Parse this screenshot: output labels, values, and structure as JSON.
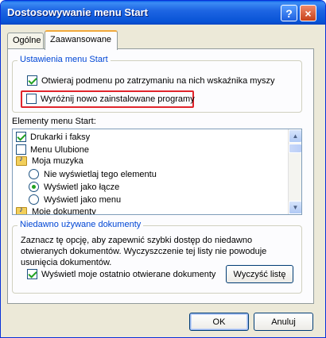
{
  "window": {
    "title": "Dostosowywanie menu Start"
  },
  "titlebar": {
    "help_label": "?",
    "close_label": "×"
  },
  "tabs": [
    {
      "label": "Ogólne",
      "active": false
    },
    {
      "label": "Zaawansowane",
      "active": true
    }
  ],
  "start_menu_settings": {
    "group_label": "Ustawienia menu Start",
    "options": [
      {
        "label": "Otwieraj podmenu po zatrzymaniu na nich wskaźnika myszy",
        "checked": true
      },
      {
        "label": "Wyróżnij nowo zainstalowane programy",
        "checked": false,
        "highlighted": true
      }
    ]
  },
  "start_menu_items": {
    "label": "Elementy menu Start:",
    "items": [
      {
        "type": "checkbox",
        "label": "Drukarki i faksy",
        "checked": true
      },
      {
        "type": "checkbox",
        "label": "Menu Ulubione",
        "checked": false
      },
      {
        "type": "folder",
        "label": "Moja muzyka",
        "icon": "music-folder-icon"
      },
      {
        "type": "radio",
        "label": "Nie wyświetlaj tego elementu",
        "selected": false
      },
      {
        "type": "radio",
        "label": "Wyświetl jako łącze",
        "selected": true
      },
      {
        "type": "radio",
        "label": "Wyświetl jako menu",
        "selected": false
      },
      {
        "type": "folder",
        "label": "Moje dokumenty",
        "icon": "documents-folder-icon"
      }
    ]
  },
  "recent_documents": {
    "group_label": "Niedawno używane dokumenty",
    "description": "Zaznacz tę opcję, aby zapewnić szybki dostęp do niedawno otwieranych dokumentów. Wyczyszczenie tej listy nie powoduje usunięcia dokumentów.",
    "option_label": "Wyświetl moje ostatnio otwierane dokumenty",
    "option_checked": true,
    "clear_button": "Wyczyść listę"
  },
  "buttons": {
    "ok": "OK",
    "cancel": "Anuluj"
  },
  "colors": {
    "title_bar": "#0853d6",
    "group_label": "#0046d5",
    "highlight_box": "#e0242b",
    "check": "#21a121"
  }
}
